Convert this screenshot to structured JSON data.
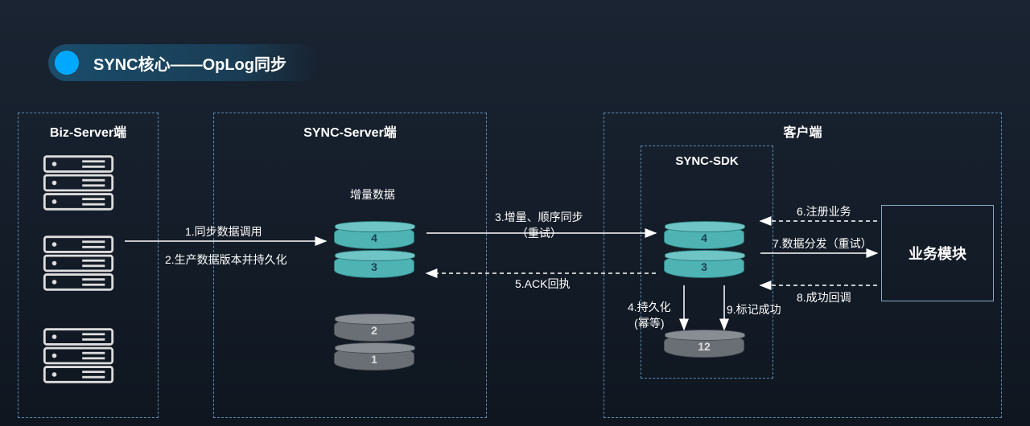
{
  "title": "SYNC核心——OpLog同步",
  "boxes": {
    "biz": "Biz-Server端",
    "sync_server": "SYNC-Server端",
    "client": "客户端",
    "sdk": "SYNC-SDK"
  },
  "inc_data_label": "增量数据",
  "biz_module": "业务模块",
  "cylinders": {
    "sync_teal": [
      "4",
      "3"
    ],
    "sync_gray": [
      "2",
      "1"
    ],
    "sdk_teal": [
      "4",
      "3"
    ],
    "sdk_gray": "12"
  },
  "arrows": {
    "a1": "1.同步数据调用",
    "a2": "2.生产数据版本并持久化",
    "a3": "3.增量、顺序同步\n（重试）",
    "a4": "4.持久化\n(幂等)",
    "a5": "5.ACK回执",
    "a6": "6.注册业务",
    "a7": "7.数据分发（重试）",
    "a8": "8.成功回调",
    "a9": "9.标记成功"
  }
}
